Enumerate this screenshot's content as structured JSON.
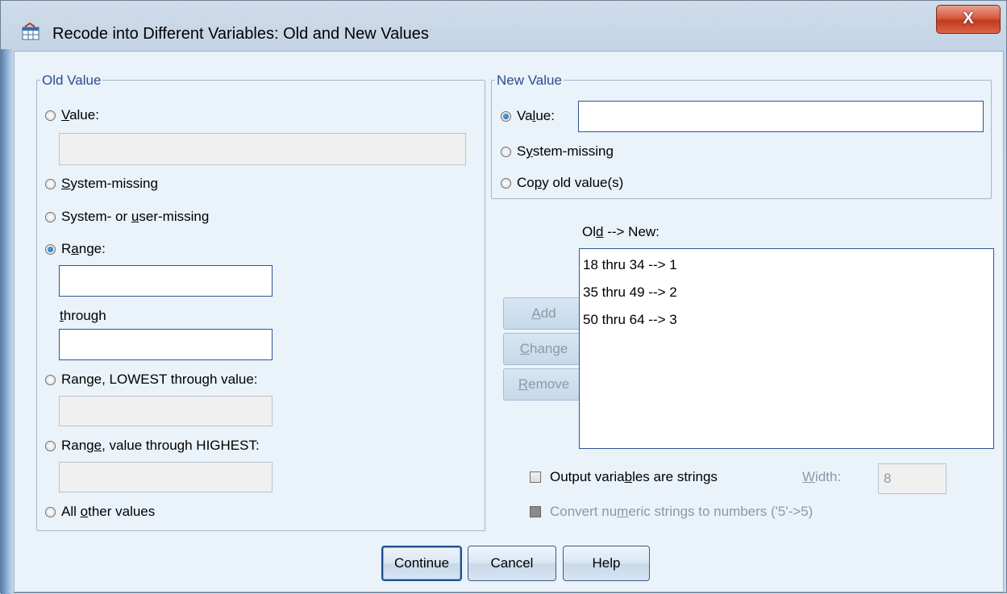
{
  "window": {
    "title": "Recode into Different Variables: Old and New Values",
    "title_icon": "recode-variables-icon",
    "close_label": "X"
  },
  "old_value": {
    "legend": "Old Value",
    "value_label_pre": "",
    "value_label_ul": "V",
    "value_label_post": "alue:",
    "value_text": "",
    "system_missing_pre": "",
    "system_missing_ul": "S",
    "system_missing_post": "ystem-missing",
    "sys_user_pre": "System- or ",
    "sys_user_ul": "u",
    "sys_user_post": "ser-missing",
    "range_pre": "R",
    "range_ul": "a",
    "range_post": "nge:",
    "range_from": "",
    "through_ul": "t",
    "through_post": "hrough",
    "range_to": "",
    "lowest_pre": "Ran",
    "lowest_ul": "g",
    "lowest_post": "e, LOWEST through value:",
    "lowest_text": "",
    "highest_pre": "Rang",
    "highest_ul": "e",
    "highest_post": ", value through HIGHEST:",
    "highest_text": "",
    "all_other_pre": "All ",
    "all_other_ul": "o",
    "all_other_post": "ther values",
    "selected": "range"
  },
  "new_value": {
    "legend": "New Value",
    "value_pre": "Va",
    "value_ul": "l",
    "value_post": "ue:",
    "value_text": "",
    "sysmiss_pre": "S",
    "sysmiss_ul": "y",
    "sysmiss_post": "stem-missing",
    "copy_pre": "Co",
    "copy_ul": "p",
    "copy_post": "y old value(s)",
    "selected": "value"
  },
  "mapping": {
    "label_pre": "Ol",
    "label_ul": "d",
    "label_post": " --> New:",
    "items": [
      "18 thru 34 --> 1",
      "35 thru 49 --> 2",
      "50 thru 64 --> 3"
    ],
    "add_ul": "A",
    "add_post": "dd",
    "change_ul": "C",
    "change_post": "hange",
    "remove_ul": "R",
    "remove_post": "emove"
  },
  "options": {
    "output_strings_pre": "Output varia",
    "output_strings_ul": "b",
    "output_strings_post": "les are strings",
    "output_strings_checked": false,
    "width_ul": "W",
    "width_post": "idth:",
    "width_value": "8",
    "convert_pre": "Convert nu",
    "convert_ul": "m",
    "convert_post": "eric strings to numbers ('5'->5)",
    "convert_enabled": false
  },
  "buttons": {
    "continue": "Continue",
    "cancel": "Cancel",
    "help": "Help"
  }
}
